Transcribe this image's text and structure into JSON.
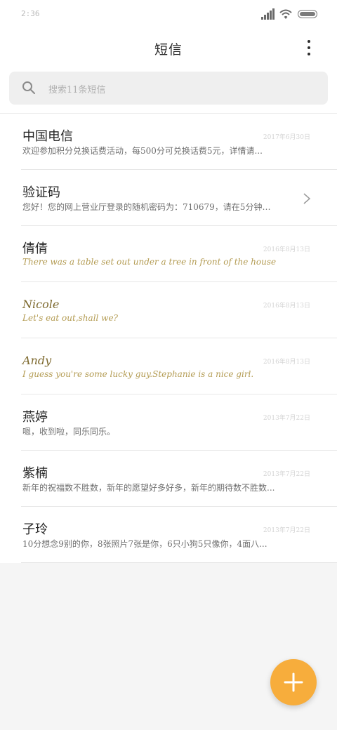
{
  "status_bar": {
    "time": "2:36",
    "icons": [
      "signal-icon",
      "wifi-icon",
      "battery-icon"
    ]
  },
  "header": {
    "title": "短信",
    "more_icon": "more-vertical-icon"
  },
  "search": {
    "placeholder": "搜索11条短信",
    "icon": "search-icon"
  },
  "messages": [
    {
      "name": "中国电信",
      "date": "2017年6月30日",
      "preview": "欢迎参加积分兑换话费活动，每500分可兑换话费5元，详情请...",
      "latin": false,
      "chevron": false
    },
    {
      "name": "验证码",
      "date": "",
      "preview": "您好！您的网上营业厅登录的随机密码为：710679，请在5分钟内...",
      "latin": false,
      "chevron": true
    },
    {
      "name": "倩倩",
      "date": "2016年8月13日",
      "preview": "There was a table set out under a tree in front of the house",
      "latin": true,
      "chevron": false
    },
    {
      "name": "Nicole",
      "date": "2016年8月13日",
      "preview": "Let's eat out,shall we?",
      "latin": true,
      "chevron": false
    },
    {
      "name": "Andy",
      "date": "2016年8月13日",
      "preview": "I guess you're some lucky guy.Stephanie is a nice girl.",
      "latin": true,
      "chevron": false
    },
    {
      "name": "燕婷",
      "date": "2013年7月22日",
      "preview": "嗯，收到啦，同乐同乐。",
      "latin": false,
      "chevron": false
    },
    {
      "name": "紫楠",
      "date": "2013年7月22日",
      "preview": "新年的祝福数不胜数，新年的愿望好多好多，新年的期待数不胜数...",
      "latin": false,
      "chevron": false
    },
    {
      "name": "子玲",
      "date": "2013年7月22日",
      "preview": "10分想念9别的你，8张照片7张是你，6只小狗5只像你，4面八...",
      "latin": false,
      "chevron": false
    }
  ],
  "fab": {
    "icon": "plus-icon"
  },
  "colors": {
    "accent": "#f7ad3c",
    "background": "#f5f5f5",
    "card": "#ffffff"
  }
}
